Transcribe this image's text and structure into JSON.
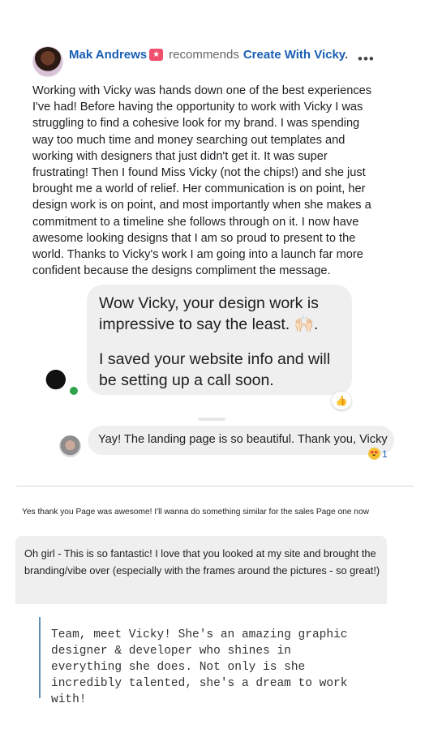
{
  "review": {
    "author": "Mak Andrews",
    "recommends_text": "recommends",
    "page_name": "Create With Vicky",
    "period": ".",
    "more": "•••",
    "body": "Working with Vicky was hands down one of the best experiences I've had! Before having the opportunity to work with Vicky I was struggling to find a cohesive look for my brand. I was spending way too much time and money searching out templates and working with designers that just didn't get it. It was super frustrating! Then I found Miss Vicky (not the chips!) and she just brought me a world of relief. Her communication is on point, her design work is on point, and most importantly when she makes a commitment to a timeline she follows through on it. I now have awesome looking designs that I am so proud to present to the world. Thanks to Vicky's work I am going into a launch far more confident because the designs compliment the message."
  },
  "chat": {
    "message1_line1": "Wow Vicky, your design work is impressive to say the least. 🙌🏻.",
    "message1_line2": "I saved your website info and will be setting up a call soon.",
    "message1_reaction": "👍",
    "message2": "Yay! The landing page is so beautiful. Thank you, Vicky",
    "message2_reaction_emoji": "😍",
    "message2_reaction_count": "1"
  },
  "plain_message": "Yes thank you Page was awesome! I'll wanna do something similar for the sales Page one now",
  "card_message": "Oh girl - This is so fantastic! I love that you looked at my site and brought the branding/vibe over (especially with the frames around the pictures - so great!)",
  "quote": "Team, meet Vicky! She's an amazing graphic designer & developer who shines in everything she does. Not only is she incredibly talented, she's a dream to work with!"
}
